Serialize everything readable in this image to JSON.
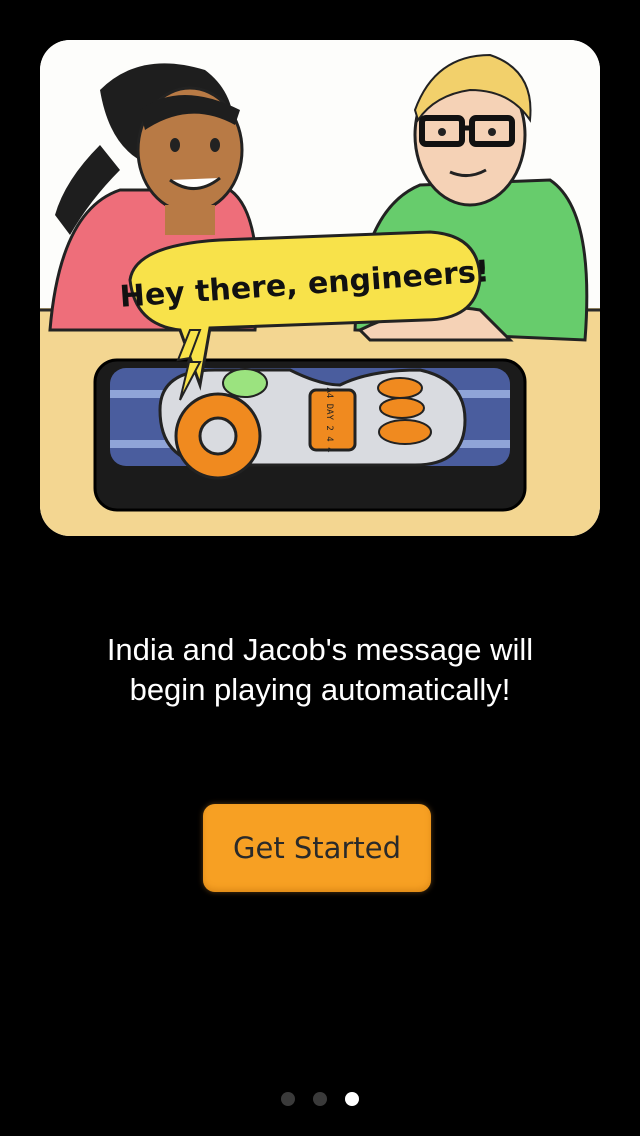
{
  "illustration": {
    "speech_bubble_text": "Hey there, engineers!",
    "device_label_text": "A4 DAY 2 4 4"
  },
  "message": {
    "text": "India and Jacob's message will\nbegin playing automatically!"
  },
  "actions": {
    "get_started_label": "Get Started"
  },
  "pager": {
    "page_count": 3,
    "current_page": 3
  },
  "colors": {
    "background": "#000000",
    "button": "#f7a023",
    "pager_active": "#ffffff",
    "pager_inactive": "#3a3a3a"
  }
}
